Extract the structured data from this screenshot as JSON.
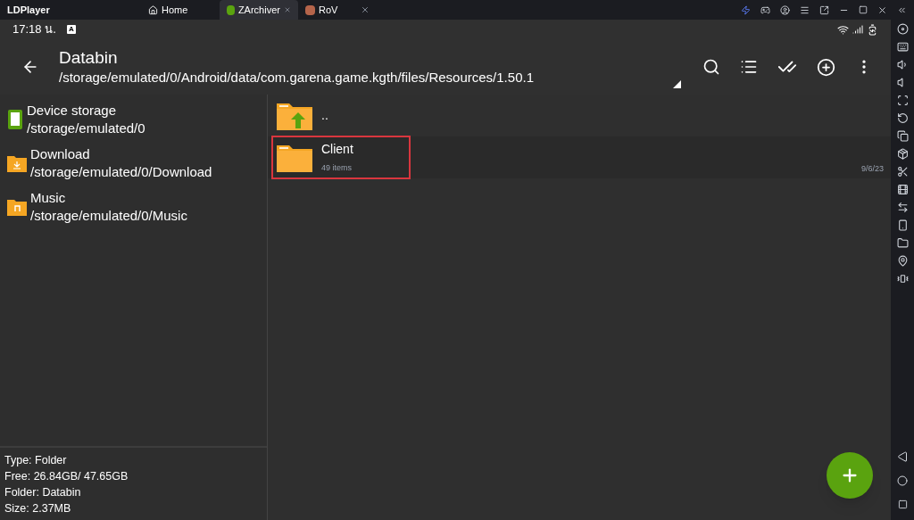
{
  "emulator": {
    "brand": "LDPlayer",
    "tabs": [
      {
        "label": "Home",
        "selected": false,
        "kind": "home"
      },
      {
        "label": "ZArchiver",
        "selected": true,
        "kind": "app"
      },
      {
        "label": "RoV",
        "selected": false,
        "kind": "app"
      }
    ]
  },
  "status_bar": {
    "time": "17:18 น.",
    "badge": "A"
  },
  "toolbar": {
    "title": "Databin",
    "path": "/storage/emulated/0/Android/data/com.garena.game.kgth/files/Resources/1.50.1"
  },
  "storages": [
    {
      "kind": "device",
      "name": "Device storage",
      "path": "/storage/emulated/0"
    },
    {
      "kind": "download",
      "name": "Download",
      "path": "/storage/emulated/0/Download"
    },
    {
      "kind": "music",
      "name": "Music",
      "path": "/storage/emulated/0/Music"
    }
  ],
  "info": [
    "Type: Folder",
    "Free: 26.84GB/ 47.65GB",
    "Folder: Databin",
    "Size: 2.37MB"
  ],
  "files": [
    {
      "kind": "parent",
      "name": "..",
      "highlighted": false
    },
    {
      "kind": "folder",
      "name": "Client",
      "details": "49 items",
      "date": "9/6/23",
      "highlighted": true
    }
  ]
}
